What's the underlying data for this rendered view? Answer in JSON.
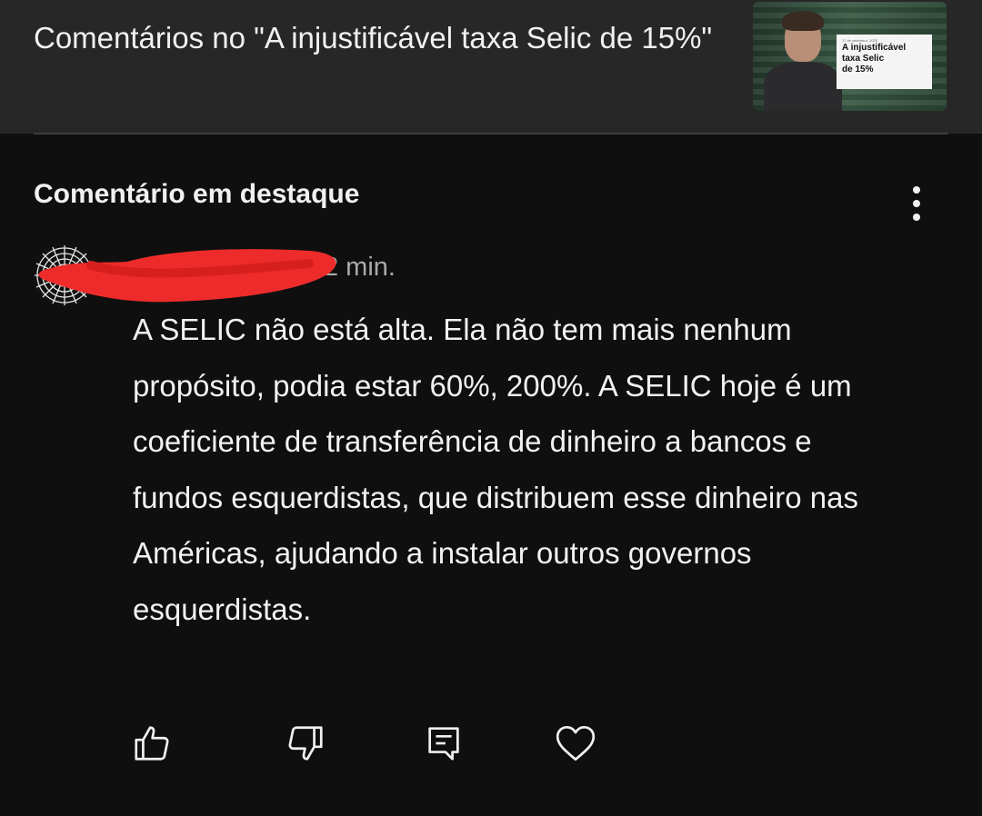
{
  "header": {
    "title": "Comentários no \"A injustificável taxa Selic de 15%\"",
    "thumbnail": {
      "date_text": "17 de setembro, 2025",
      "card_title_lines": [
        "A injustificável",
        "taxa Selic",
        "de 15%"
      ]
    }
  },
  "section": {
    "label": "Comentário em destaque",
    "menu_icon": "more-vert-icon"
  },
  "comment": {
    "author": "",
    "time": "2 min.",
    "text": "A SELIC não está alta. Ela não tem mais nenhum propósito, podia estar 60%, 200%. A SELIC hoje é um coeficiente de transferência de dinheiro a bancos e fundos esquerdistas, que distribuem esse dinheiro nas Américas, ajudando a instalar outros governos esquerdistas."
  },
  "actions": [
    {
      "icon": "thumbs-up-icon"
    },
    {
      "icon": "thumbs-down-icon"
    },
    {
      "icon": "reply-icon"
    },
    {
      "icon": "heart-icon"
    }
  ],
  "colors": {
    "background": "#0f0f0f",
    "header_background": "#272727",
    "text_primary": "#f1f1f1",
    "text_secondary": "#aaaaaa",
    "redaction": "#ee2b2b"
  }
}
